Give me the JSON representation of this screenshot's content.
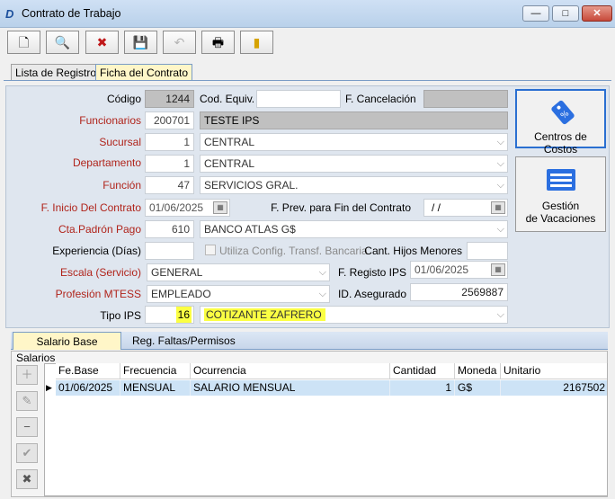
{
  "window": {
    "title": "Contrato de Trabajo",
    "app_icon_glyph": "D",
    "controls": {
      "minimize": "—",
      "maximize": "□",
      "close": "✕"
    }
  },
  "toolbar": {
    "new_glyph": "🗋",
    "search_glyph": "🔍",
    "delete_glyph": "✖",
    "save_glyph": "💾",
    "undo_glyph": "↶",
    "print_glyph": "🖶",
    "exit_glyph": "▮"
  },
  "tabs": {
    "list_label": "Lista de Registros",
    "detail_label": "Ficha del Contrato"
  },
  "form": {
    "codigo_label": "Código",
    "codigo_value": "1244",
    "cod_equiv_label": "Cod. Equiv.",
    "cod_equiv_value": "",
    "f_cancelacion_label": "F. Cancelación",
    "f_cancelacion_value": "",
    "funcionarios_label": "Funcionarios",
    "funcionario_code": "200701",
    "funcionario_name": "TESTE IPS",
    "sucursal_label": "Sucursal",
    "sucursal_code": "1",
    "sucursal_name": "CENTRAL",
    "departamento_label": "Departamento",
    "departamento_code": "1",
    "departamento_name": "CENTRAL",
    "funcion_label": "Función",
    "funcion_code": "47",
    "funcion_name": "SERVICIOS GRAL.",
    "f_inicio_label": "F. Inicio Del Contrato",
    "f_inicio_value": "01/06/2025",
    "f_prev_fin_label": "F. Prev. para Fin del Contrato",
    "f_prev_fin_value": "/  /",
    "cta_padron_label": "Cta.Padrón Pago",
    "cta_padron_code": "610",
    "cta_padron_name": "BANCO ATLAS G$",
    "experiencia_label": "Experiencia (Días)",
    "experiencia_value": "",
    "utiliza_config_label": "Utiliza Config. Transf. Bancaria",
    "cant_hijos_label": "Cant. Hijos Menores",
    "cant_hijos_value": "",
    "escala_label": "Escala (Servicio)",
    "escala_value": "GENERAL",
    "f_registo_ips_label": "F. Registo IPS",
    "f_registo_ips_value": "01/06/2025",
    "profesion_label": "Profesión MTESS",
    "profesion_value": "EMPLEADO",
    "id_asegurado_label": "ID. Asegurado",
    "id_asegurado_value": "2569887",
    "tipo_ips_label": "Tipo IPS",
    "tipo_ips_code": "16",
    "tipo_ips_name": "COTIZANTE ZAFRERO"
  },
  "side_buttons": {
    "centros_label": "Centros de Costos",
    "gestion_line1": "Gestión",
    "gestion_line2": "de Vacaciones"
  },
  "subtabs": {
    "salario_label": "Salario Base",
    "faltas_label": "Reg. Faltas/Permisos"
  },
  "salarios": {
    "section_label": "Salarios",
    "columns": [
      "Fe.Base",
      "Frecuencia",
      "Ocurrencia",
      "Cantidad",
      "Moneda",
      "Unitario"
    ],
    "rows": [
      {
        "fe_base": "01/06/2025",
        "frecuencia": "MENSUAL",
        "ocurrencia": "SALARIO MENSUAL",
        "cantidad": "1",
        "moneda": "G$",
        "unitario": "2167502"
      }
    ],
    "row_marker": "▶"
  },
  "grid_buttons": {
    "add_glyph": "＋",
    "edit_glyph": "✎",
    "remove_glyph": "−",
    "confirm_glyph": "✔",
    "cancel_glyph": "✖"
  }
}
